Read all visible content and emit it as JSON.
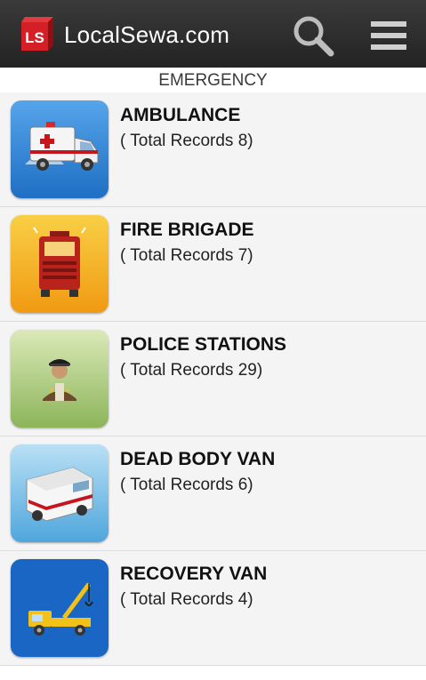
{
  "app_bar": {
    "logo_text": "LS",
    "title": "LocalSewa.com",
    "search_icon": "search-icon",
    "menu_icon": "menu-icon"
  },
  "section": {
    "title": "EMERGENCY"
  },
  "items": [
    {
      "title": "AMBULANCE",
      "count": "( Total Records 8)",
      "icon": "ambulance-icon",
      "tile_color": "#2a7bd0"
    },
    {
      "title": "FIRE BRIGADE",
      "count": "( Total Records 7)",
      "icon": "fire-truck-icon",
      "tile_color": "#f2b01e"
    },
    {
      "title": "POLICE STATIONS",
      "count": "( Total Records 29)",
      "icon": "police-officer-icon",
      "tile_color": "#a9c873"
    },
    {
      "title": "DEAD BODY VAN",
      "count": "( Total Records 6)",
      "icon": "van-icon",
      "tile_color": "#6fb9e6"
    },
    {
      "title": "RECOVERY VAN",
      "count": "( Total Records 4)",
      "icon": "tow-truck-icon",
      "tile_color": "#1a66c4"
    }
  ]
}
